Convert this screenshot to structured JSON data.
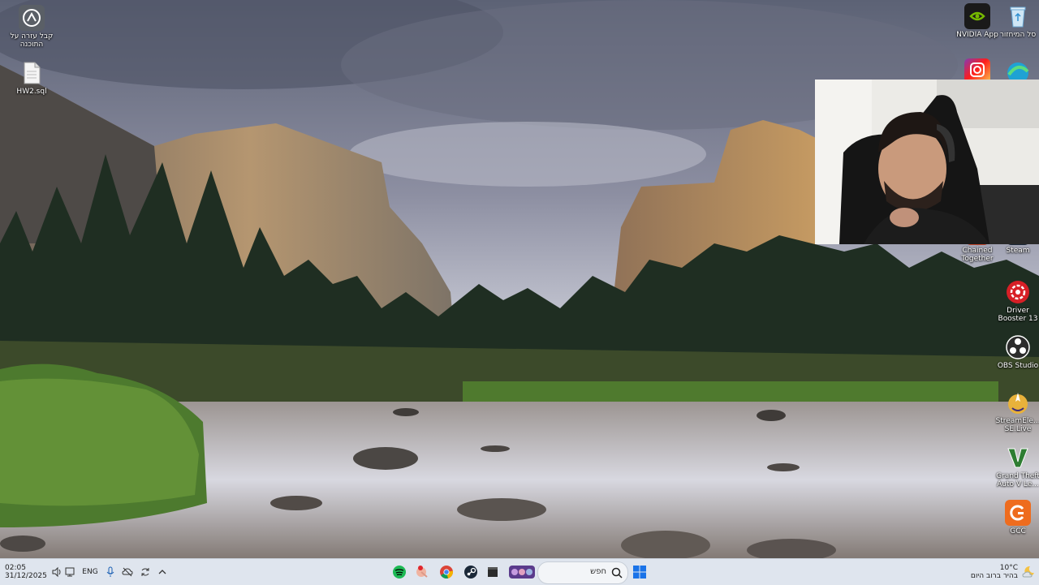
{
  "desktop": {
    "left_icons": [
      {
        "name": "acrobat-shortcut-icon",
        "label": "קבל עזרה על\nהתוכנה"
      },
      {
        "name": "sql-file-icon",
        "label": "HW2.sql"
      }
    ],
    "right_icons": [
      {
        "name": "nvidia-app-icon",
        "label": "NVIDIA App"
      },
      {
        "name": "recycle-bin-icon",
        "label": "סל המיחזור"
      },
      {
        "name": "chained-together-icon",
        "label": "Chained\nTogether"
      },
      {
        "name": "steam-icon",
        "label": "Steam"
      },
      {
        "name": "driver-booster-icon",
        "label": "Driver\nBooster 13"
      },
      {
        "name": "obs-studio-icon",
        "label": "OBS Studio"
      },
      {
        "name": "streamelements-icon",
        "label": "StreamEle...\nSE.Live"
      },
      {
        "name": "gta-v-icon",
        "label": "Grand Theft\nAuto V Le..."
      },
      {
        "name": "gcc-icon",
        "label": "GCC"
      }
    ]
  },
  "taskbar": {
    "clock_time": "02:05",
    "clock_date": "31/12/2025",
    "language": "ENG",
    "search_placeholder": "חפש",
    "weather_temp": "10°C",
    "weather_text": "בהיר ברוב היום",
    "apps": [
      "spotify-icon",
      "file-explorer-icon",
      "chrome-icon",
      "steam-icon",
      "window-app-icon",
      "game-bar-icon"
    ]
  },
  "colors": {
    "taskbar_bg": "#dfe5ee",
    "windows_blue": "#1a73e8",
    "spotify_green": "#1db954"
  }
}
